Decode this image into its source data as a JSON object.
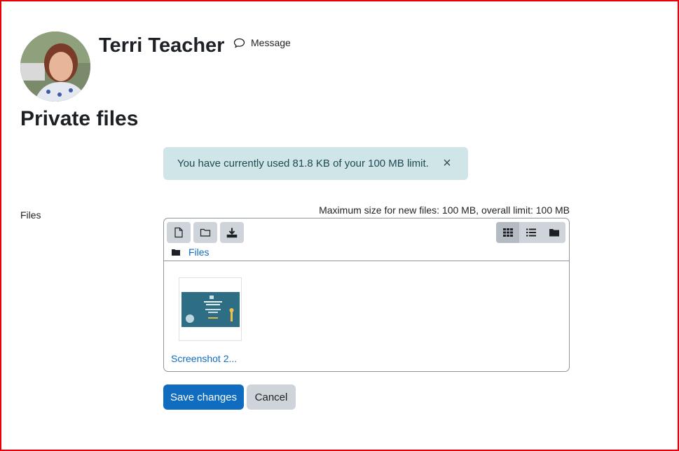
{
  "profile": {
    "name": "Terri Teacher",
    "message_label": "Message"
  },
  "page": {
    "title": "Private files"
  },
  "alert": {
    "text": "You have currently used 81.8 KB of your 100 MB limit.",
    "close_glyph": "×"
  },
  "form": {
    "files_label": "Files",
    "limit_text": "Maximum size for new files: 100 MB, overall limit: 100 MB"
  },
  "filemanager": {
    "toolbar": {
      "actions": [
        "add-file-icon",
        "create-folder-icon",
        "download-icon"
      ],
      "views": [
        "grid-view-icon",
        "list-view-icon",
        "tree-view-icon"
      ],
      "active_view": "grid-view-icon"
    },
    "breadcrumb": "Files",
    "files": [
      {
        "name": "Screenshot 2..."
      }
    ]
  },
  "buttons": {
    "save": "Save changes",
    "cancel": "Cancel"
  },
  "colors": {
    "primary": "#0f6cbf",
    "alert_bg": "#cfe5e8",
    "frame": "#e8000b"
  }
}
